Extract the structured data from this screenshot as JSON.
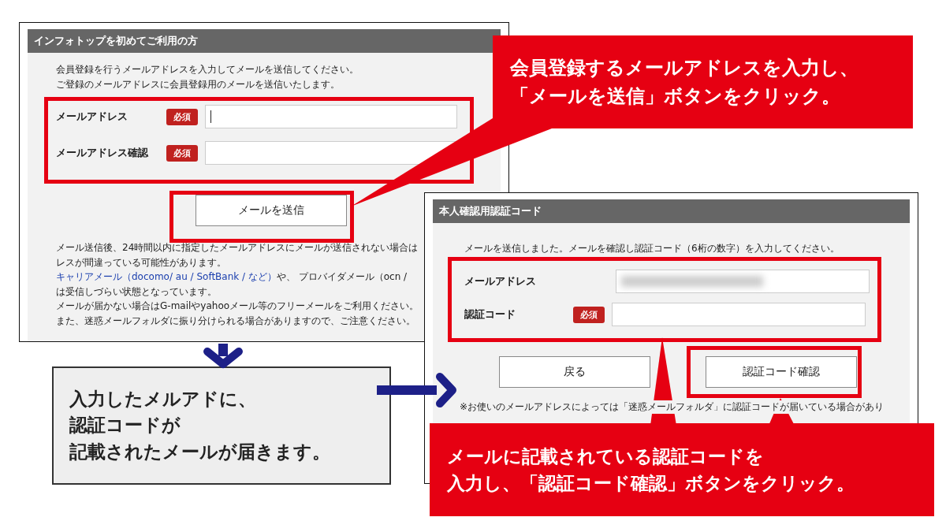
{
  "signup_form": {
    "title": "インフォトップを初めてご利用の方",
    "intro": [
      "会員登録を行うメールアドレスを入力してメールを送信してください。",
      "ご登録のメールアドレスに会員登録用のメールを送信いたします。"
    ],
    "fields": [
      {
        "label": "メールアドレス",
        "required": true,
        "badge": "必須",
        "focused": true
      },
      {
        "label": "メールアドレス確認",
        "required": true,
        "badge": "必須",
        "focused": false
      }
    ],
    "button": "メールを送信",
    "notes": [
      {
        "kind": "text",
        "text": "メール送信後、24時間以内に指定したメールアドレスにメールが送信されない場合は"
      },
      {
        "kind": "text",
        "text": "レスが間違っている可能性があります。"
      },
      {
        "kind": "link",
        "link": "キャリアメール（docomo/ au / SoftBank / など）",
        "text": "や、 プロバイダメール（ocn / "
      },
      {
        "kind": "text",
        "text": "は受信しづらい状態となっています。"
      },
      {
        "kind": "text",
        "text": "メールが届かない場合はG-mailやyahooメール等のフリーメールをご利用ください。"
      },
      {
        "kind": "text",
        "text": "また、迷惑メールフォルダに振り分けられる場合がありますので、ご注意ください。"
      }
    ]
  },
  "verify_form": {
    "title": "本人確認用認証コード",
    "intro": "メールを送信しました。メールを確認し認証コード（6桁の数字）を入力してください。",
    "fields": [
      {
        "label": "メールアドレス",
        "required": false,
        "blurred": true
      },
      {
        "label": "認証コード",
        "required": true,
        "badge": "必須",
        "blurred": false
      }
    ],
    "buttons": [
      "戻る",
      "認証コード確認"
    ],
    "footnote": "※お使いのメールアドレスによっては「迷惑メールフォルダ」に認証コードが届いている場合があり"
  },
  "callouts": [
    {
      "lines": [
        "会員登録するメールアドレスを入力し、",
        "「メールを送信」ボタンをクリック。"
      ]
    },
    {
      "lines": [
        "メールに記載されている認証コードを",
        "入力し、「認証コード確認」ボタンをクリック。"
      ]
    }
  ],
  "note": {
    "lines": [
      "入力したメルアドに、",
      "認証コードが",
      "記載されたメールが届きます。"
    ]
  }
}
